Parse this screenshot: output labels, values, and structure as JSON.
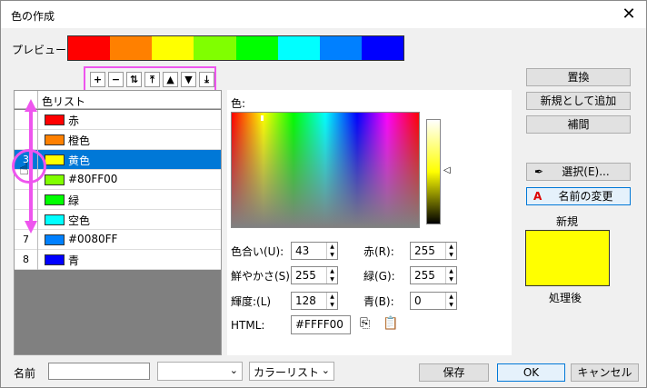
{
  "window": {
    "title": "色の作成",
    "close_icon": "close-icon"
  },
  "preview": {
    "label": "プレビュー",
    "colors": [
      "#ff0000",
      "#ff8000",
      "#ffff00",
      "#80ff00",
      "#00ff00",
      "#00ffff",
      "#0080ff",
      "#0000ff"
    ]
  },
  "toolbar": {
    "buttons": [
      {
        "icon": "plus-icon",
        "glyph": "+"
      },
      {
        "icon": "minus-icon",
        "glyph": "−"
      },
      {
        "icon": "swap-icon",
        "glyph": "⇅"
      },
      {
        "icon": "move-top-icon",
        "glyph": "⤒"
      },
      {
        "icon": "move-up-icon",
        "glyph": "▲"
      },
      {
        "icon": "move-down-icon",
        "glyph": "▼"
      },
      {
        "icon": "move-bottom-icon",
        "glyph": "⤓"
      }
    ]
  },
  "list": {
    "header": "色リスト",
    "rows": [
      {
        "num": "",
        "color": "#ff0000",
        "name": "赤"
      },
      {
        "num": "",
        "color": "#ff8000",
        "name": "橙色"
      },
      {
        "num": "3",
        "color": "#ffff00",
        "name": "黄色"
      },
      {
        "num": "",
        "color": "#80ff00",
        "name": "#80FF00"
      },
      {
        "num": "",
        "color": "#00ff00",
        "name": "緑"
      },
      {
        "num": "",
        "color": "#00ffff",
        "name": "空色"
      },
      {
        "num": "7",
        "color": "#0080ff",
        "name": "#0080FF"
      },
      {
        "num": "8",
        "color": "#0000ff",
        "name": "青"
      }
    ],
    "selected_index": 2
  },
  "picker": {
    "label": "色:",
    "hue_label": "色合い(U):",
    "hue": "43",
    "sat_label": "鮮やかさ(S):",
    "sat": "255",
    "lum_label": "輝度:(L)",
    "lum": "128",
    "red_label": "赤(R):",
    "red": "255",
    "green_label": "緑(G):",
    "green": "255",
    "blue_label": "青(B):",
    "blue": "0",
    "html_label": "HTML:",
    "html": "#FFFF00"
  },
  "side": {
    "replace": "置換",
    "add_new": "新規として追加",
    "interpolate": "補間",
    "select": "選択(E)...",
    "rename": "名前の変更",
    "new_label": "新規",
    "new_color": "#ffff00",
    "after_label": "処理後"
  },
  "bottom": {
    "name_label": "名前",
    "name_value": "",
    "combo1": "",
    "combo2": "カラーリスト",
    "save": "保存",
    "ok": "OK",
    "cancel": "キャンセル"
  }
}
